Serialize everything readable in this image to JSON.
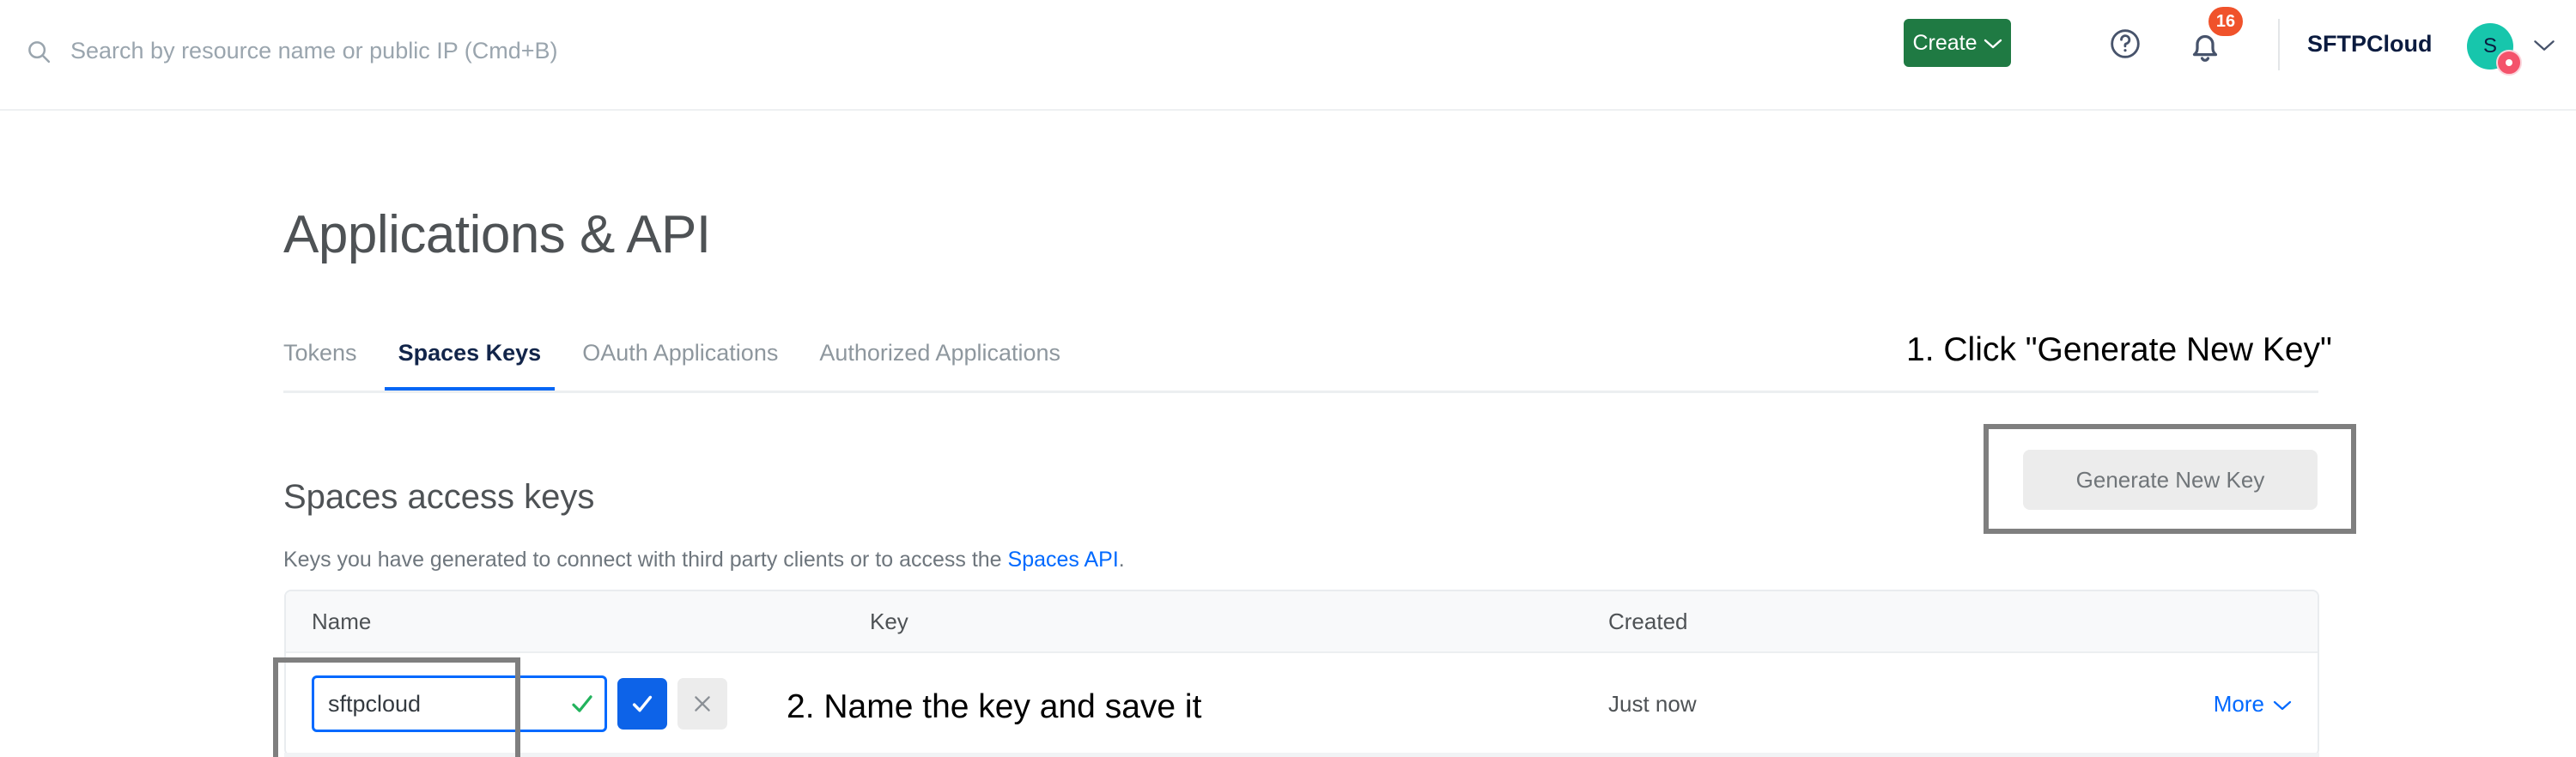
{
  "topnav": {
    "search": {
      "placeholder": "Search by resource name or public IP (Cmd+B)",
      "value": ""
    },
    "create_label": "Create",
    "create_chevron": "⌄",
    "notification_count": "16",
    "account_name": "SFTPCloud",
    "avatar_initial": "S",
    "colors": {
      "create_green": "#1f7a43",
      "badge_orange": "#f0522b",
      "avatar_teal": "#17c6ac",
      "avatar_badge_pink": "#f4536b"
    }
  },
  "main": {
    "page_title": "Applications & API",
    "tabs": [
      {
        "label": "Tokens",
        "active": false
      },
      {
        "label": "Spaces Keys",
        "active": true
      },
      {
        "label": "OAuth Applications",
        "active": false
      },
      {
        "label": "Authorized Applications",
        "active": false
      }
    ],
    "section_title": "Spaces access keys",
    "section_desc_prefix": "Keys you have generated to connect with third party clients or to access the ",
    "section_desc_link": "Spaces API",
    "section_desc_suffix": ".",
    "generate_key_label": "Generate New Key",
    "table": {
      "columns": [
        "Name",
        "Key",
        "Created",
        ""
      ],
      "rows": [
        {
          "name_value": "sftpcloud",
          "key_value": "",
          "created": "Just now",
          "more_label": "More",
          "more_chevron": "⌄"
        }
      ]
    }
  },
  "annotations": [
    {
      "id": "step-1",
      "text": "1. Click \"Generate New Key\""
    },
    {
      "id": "step-2",
      "text": "2. Name the key and save it"
    }
  ]
}
